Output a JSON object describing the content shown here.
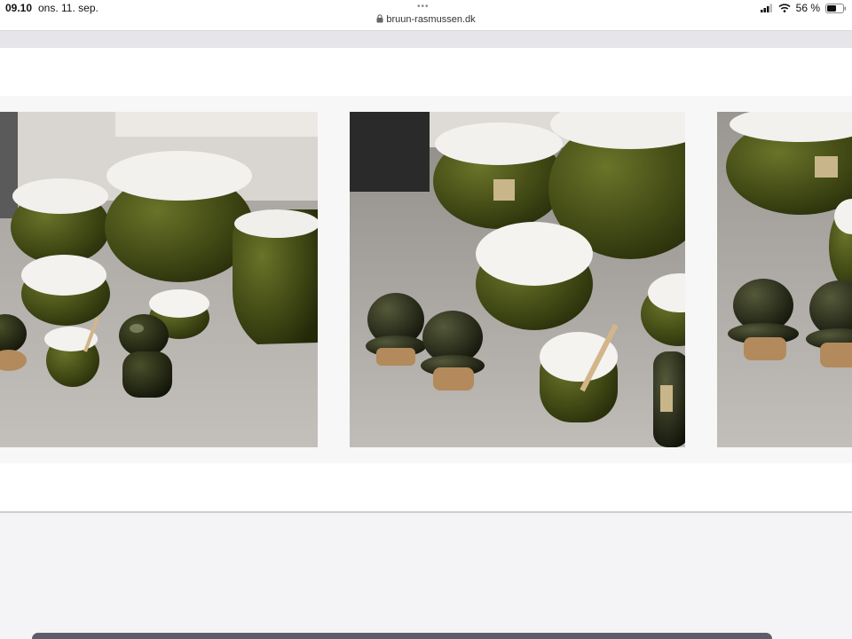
{
  "status_bar": {
    "time": "09.10",
    "date": "ons. 11. sep.",
    "url": "bruun-rasmussen.dk",
    "battery": "56 %"
  },
  "icons": {
    "lock": "lock-icon",
    "signal": "cellular-signal-icon",
    "wifi": "wifi-icon",
    "battery": "battery-icon",
    "more": "more-dots-icon"
  },
  "gallery": {
    "images": [
      {
        "subject": "olive green ceramic bowls, jug and jars on grey table"
      },
      {
        "subject": "olive green ceramic bowls and cork-lidded jars"
      },
      {
        "subject": "olive green ceramic bowl and jars, partially visible"
      }
    ]
  },
  "colors": {
    "glaze_olive": "#4a5318",
    "glaze_dark": "#1f2410",
    "cork": "#b38a5c",
    "table": "#b5b1ad"
  }
}
